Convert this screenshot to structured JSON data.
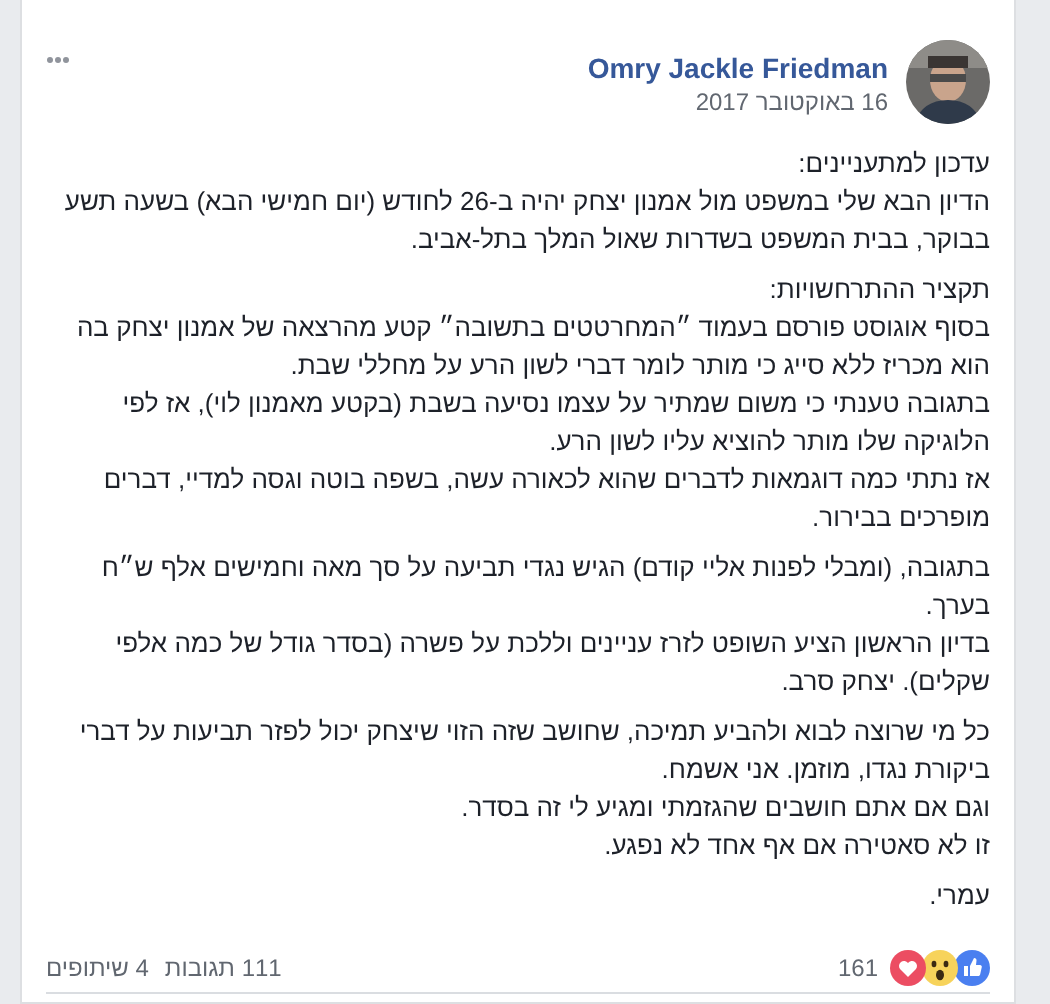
{
  "post": {
    "author": "Omry Jackle Friedman",
    "date": "16 באוקטובר 2017",
    "paragraphs": [
      [
        "עדכון למתעניינים:",
        "הדיון הבא שלי במשפט מול אמנון יצחק יהיה ב-26 לחודש (יום חמישי הבא) בשעה תשע בבוקר, בבית המשפט בשדרות שאול המלך בתל-אביב."
      ],
      [
        "תקציר ההתרחשויות:",
        "בסוף אוגוסט פורסם בעמוד ״המחרטטים בתשובה״ קטע מהרצאה של אמנון יצחק בה הוא מכריז ללא סייג כי מותר לומר דברי לשון הרע על מחללי שבת.",
        "בתגובה טענתי כי משום שמתיר על עצמו נסיעה בשבת (בקטע מאמנון לוי), אז לפי הלוגיקה שלו מותר להוציא עליו לשון הרע.",
        "אז נתתי כמה דוגמאות לדברים שהוא לכאורה עשה, בשפה בוטה וגסה למדיי, דברים מופרכים בבירור."
      ],
      [
        "בתגובה, (ומבלי לפנות אליי קודם) הגיש נגדי תביעה על סך מאה וחמישים אלף ש״ח בערך.",
        "בדיון הראשון הציע השופט לזרז עניינים וללכת על פשרה (בסדר גודל של כמה אלפי שקלים). יצחק סרב."
      ],
      [
        "כל מי שרוצה לבוא ולהביע תמיכה, שחושב שזה הזוי שיצחק יכול לפזר תביעות על דברי ביקורת נגדו, מוזמן. אני אשמח.",
        "וגם אם אתם חושבים שהגזמתי ומגיע לי זה בסדר.",
        "זו לא סאטירה אם אף אחד לא נפגע."
      ],
      [
        "עמרי."
      ]
    ],
    "reactions_count": "161",
    "comments": "111 תגובות",
    "shares": "4 שיתופים"
  }
}
